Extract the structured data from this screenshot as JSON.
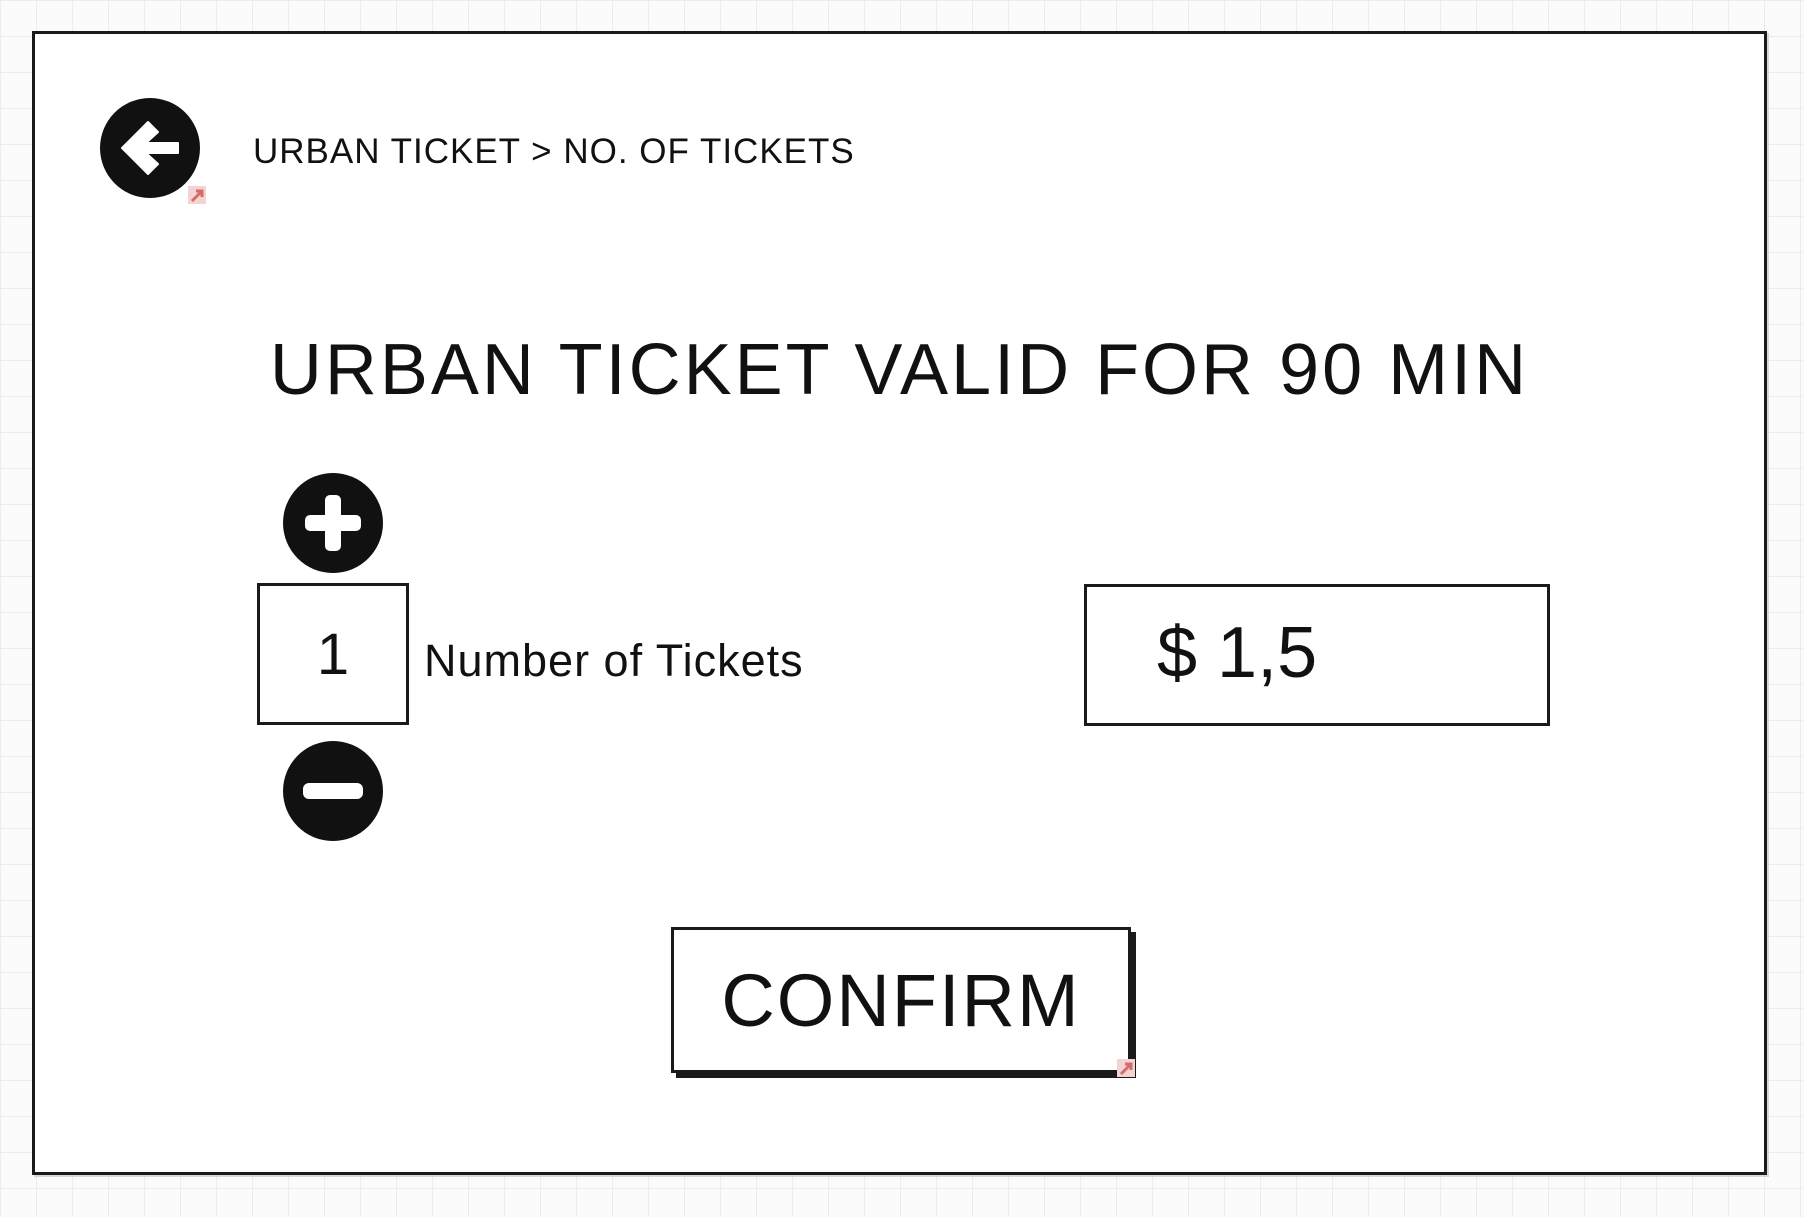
{
  "header": {
    "back_icon": "arrow-left-circle-icon",
    "breadcrumb": "URBAN TICKET > NO. OF TICKETS"
  },
  "main": {
    "title": "URBAN TICKET VALID FOR 90 MIN",
    "quantity": {
      "value": "1",
      "label": "Number of Tickets",
      "increase_icon": "plus-circle-icon",
      "decrease_icon": "minus-circle-icon"
    },
    "price": "$ 1,5",
    "confirm_label": "CONFIRM"
  },
  "colors": {
    "ink": "#111111",
    "link_marker": "#e07070",
    "grid": "#ececec"
  }
}
